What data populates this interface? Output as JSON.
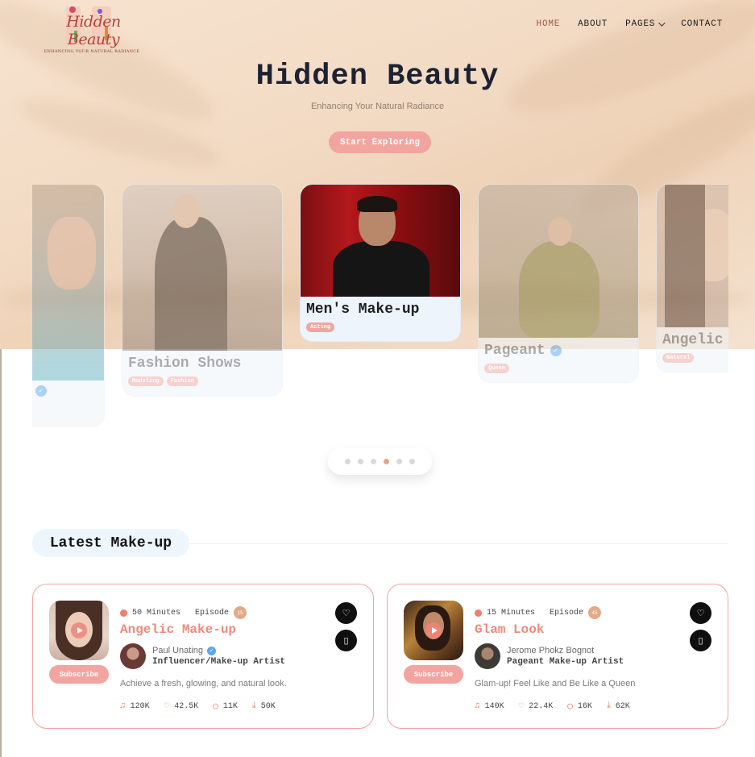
{
  "brand": {
    "logo_text": "Hidden Beauty",
    "logo_tagline": "ENHANCING YOUR NATURAL RADIANCE"
  },
  "nav": {
    "items": [
      {
        "label": "HOME",
        "active": true
      },
      {
        "label": "ABOUT",
        "active": false
      },
      {
        "label": "PAGES",
        "active": false,
        "dropdown": true
      },
      {
        "label": "CONTACT",
        "active": false
      }
    ]
  },
  "hero": {
    "title": "Hidden Beauty",
    "subtitle": "Enhancing Your Natural Radiance",
    "cta_label": "Start Exploring"
  },
  "carousel": {
    "cards": [
      {
        "title": "",
        "tags": [],
        "verified": true
      },
      {
        "title": "Fashion Shows",
        "tags": [
          "Modeling",
          "Fashion"
        ],
        "verified": false
      },
      {
        "title": "Men's Make-up",
        "tags": [
          "Acting"
        ],
        "verified": false
      },
      {
        "title": "Pageant",
        "tags": [
          "Queen"
        ],
        "verified": true
      },
      {
        "title": "Angelic",
        "tags": [
          "Natural"
        ],
        "verified": false
      }
    ],
    "page_count": 6,
    "active_index": 3
  },
  "section": {
    "title": "Latest Make-up"
  },
  "episodes": [
    {
      "duration": "50 Minutes",
      "episode_label": "Episode",
      "episode_number": "15",
      "title": "Angelic Make-up",
      "author": "Paul Unating",
      "verified": true,
      "role": "Influencer/Make-up Artist",
      "description": "Achieve a fresh, glowing, and natural look.",
      "subscribe_label": "Subscribe",
      "stats": {
        "listens": "120K",
        "likes": "42.5K",
        "comments": "11K",
        "downloads": "50K"
      }
    },
    {
      "duration": "15 Minutes",
      "episode_label": "Episode",
      "episode_number": "45",
      "title": "Glam Look",
      "author": "Jerome Phokz Bognot",
      "verified": false,
      "role": "Pageant Make-up Artist",
      "description": "Glam-up! Feel Like and Be Like a Queen",
      "subscribe_label": "Subscribe",
      "stats": {
        "listens": "140K",
        "likes": "22.4K",
        "comments": "16K",
        "downloads": "62K"
      }
    }
  ],
  "colors": {
    "accent": "#f2a5a0",
    "title_accent": "#ef8a7c",
    "nav_active": "#a2563e",
    "hero_bg": "#f3dcc6"
  }
}
